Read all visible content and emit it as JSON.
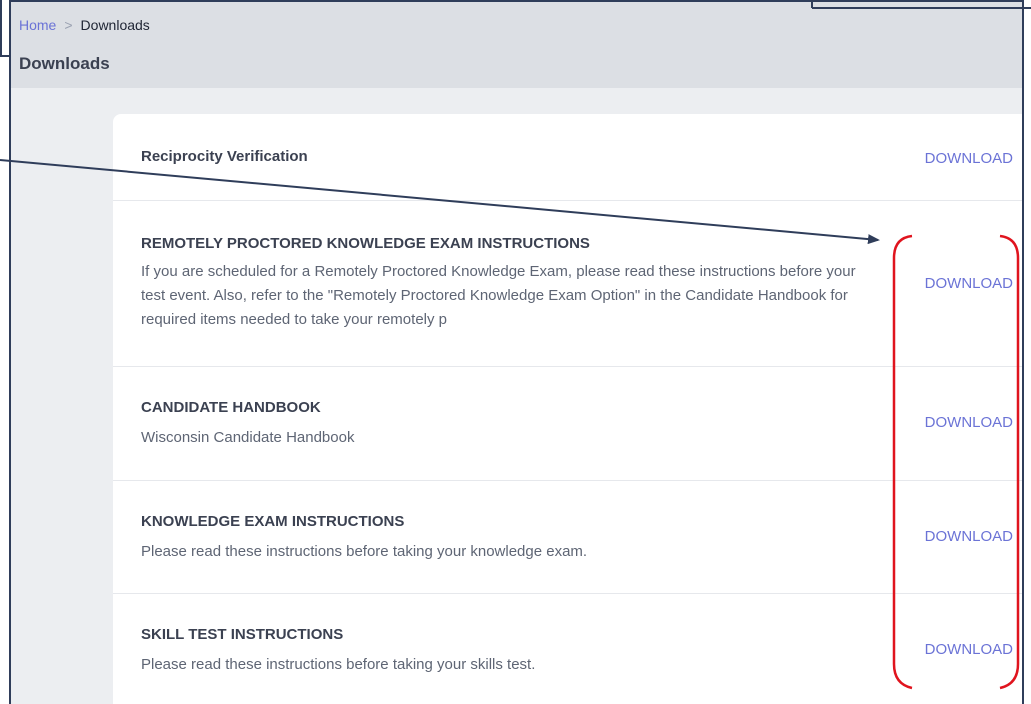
{
  "breadcrumb": {
    "home": "Home",
    "separator": ">",
    "current": "Downloads"
  },
  "page": {
    "title": "Downloads"
  },
  "downloads": [
    {
      "title": "Reciprocity Verification",
      "description": "",
      "action": "DOWNLOAD"
    },
    {
      "title": "REMOTELY PROCTORED KNOWLEDGE EXAM INSTRUCTIONS",
      "description": "If you are scheduled for a Remotely Proctored Knowledge Exam, please read these instructions before your test event. Also, refer to the \"Remotely Proctored Knowledge Exam Option\" in the Candidate Handbook for required items needed to take your remotely p",
      "action": "DOWNLOAD"
    },
    {
      "title": "CANDIDATE HANDBOOK",
      "description": "Wisconsin Candidate Handbook",
      "action": "DOWNLOAD"
    },
    {
      "title": "KNOWLEDGE EXAM INSTRUCTIONS",
      "description": "Please read these instructions before taking your knowledge exam.",
      "action": "DOWNLOAD"
    },
    {
      "title": "SKILL TEST INSTRUCTIONS",
      "description": "Please read these instructions before taking your skills test.",
      "action": "DOWNLOAD"
    }
  ],
  "colors": {
    "accent": "#6b73d6",
    "annotation_arrow": "#2f3d5a",
    "annotation_bracket": "#e0141e"
  },
  "icons": {
    "separator": "chevron-right-icon"
  }
}
